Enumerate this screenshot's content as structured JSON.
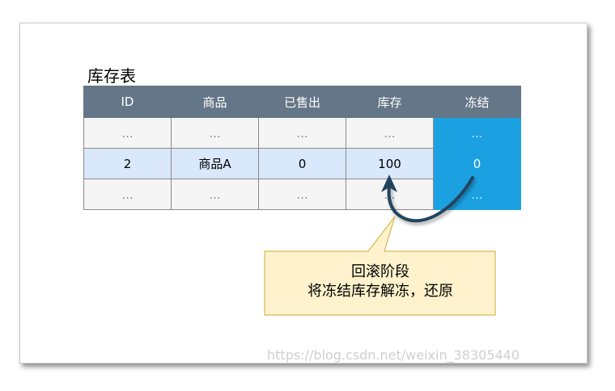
{
  "caption": "库存表",
  "table": {
    "headers": [
      "ID",
      "商品",
      "已售出",
      "库存",
      "冻结"
    ],
    "rows": [
      [
        "...",
        "...",
        "...",
        "...",
        "..."
      ],
      [
        "2",
        "商品A",
        "0",
        "100",
        "0"
      ],
      [
        "...",
        "...",
        "...",
        "...",
        "..."
      ]
    ]
  },
  "note": {
    "title": "回滚阶段",
    "body": "将冻结库存解冻，还原"
  },
  "watermark": "https://blog.csdn.net/weixin_38305440",
  "colors": {
    "header": "#647687",
    "highlight_row": "#dae8fc",
    "frozen_column": "#1ba1e2",
    "note_fill": "#fff2cc",
    "note_border": "#d6b656",
    "arrow": "#23445d"
  }
}
